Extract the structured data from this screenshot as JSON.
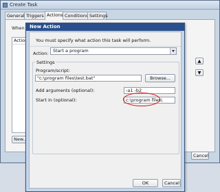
{
  "outer_window": {
    "title": "Create Task",
    "tabs": [
      {
        "label": "General"
      },
      {
        "label": "Triggers"
      },
      {
        "label": "Actions"
      },
      {
        "label": "Conditions"
      },
      {
        "label": "Settings"
      }
    ],
    "active_tab": "Actions",
    "intro_text": "When you",
    "list_header": "Action",
    "new_button": "New...",
    "cancel_button": "Cancel",
    "side_buttons": [
      "▲",
      "▼"
    ]
  },
  "dialog": {
    "title": "New Action",
    "message": "You must specify what action this task will perform.",
    "action_label": "Action:",
    "action_value": "Start a program",
    "settings_label": "Settings",
    "program_label": "Program/script:",
    "program_value": "\"c:\\program files\\test.bat\"",
    "browse_button": "Browse...",
    "args_label": "Add arguments (optional):",
    "args_value": "-a1 -b2",
    "start_label": "Start in (optional):",
    "start_value": "c:\\program files\\",
    "ok_button": "OK",
    "cancel_button": "Cancel"
  },
  "colors": {
    "dialog_title_bg": "#2a4f8c",
    "annotation_circle": "#d41010"
  }
}
